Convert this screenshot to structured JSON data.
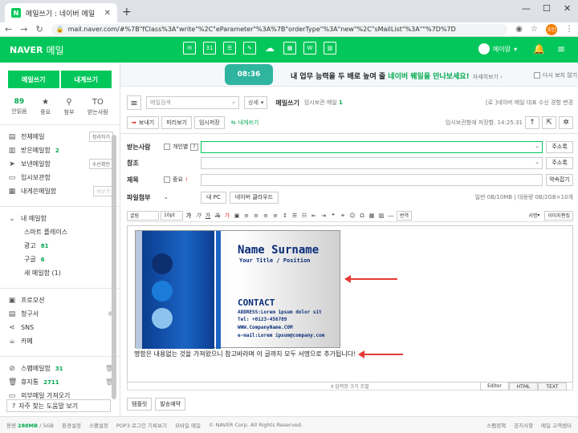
{
  "browser": {
    "tab_title": "메일쓰기 : 네이버 메일",
    "favicon": "N",
    "url": "mail.naver.com/#%7B\"fClass%3A\"write\"%2C\"eParameter\"%3A%7B\"orderType\"%3A\"new\"%2C\"sMailList\"%3A\"\"%7D%7D",
    "profile_label": "초안"
  },
  "gnb": {
    "logo_brand": "NAVER",
    "logo_service": "메일",
    "user_name": "메이랑",
    "calendar_day": "31"
  },
  "sidebar": {
    "write_btn": "메일쓰기",
    "self_btn": "내게쓰기",
    "quick": [
      {
        "count": "89",
        "label": "안읽음"
      },
      {
        "icon": "★",
        "label": "중요"
      },
      {
        "icon": "⚲",
        "label": "첨부"
      },
      {
        "icon": "TO",
        "label": "받는사람"
      }
    ],
    "folders": [
      {
        "label": "전체메일",
        "btn": "정리하기"
      },
      {
        "label": "받은메일함",
        "count": "2"
      },
      {
        "label": "보낸메일함",
        "btn": "수신확인"
      },
      {
        "label": "임시보관함"
      },
      {
        "label": "내게쓴메일함",
        "btn": "비우기"
      }
    ],
    "my_folder": "내 메일함",
    "subfolders": [
      {
        "label": "스마트 플레이스"
      },
      {
        "label": "광고",
        "count": "81"
      },
      {
        "label": "구글",
        "count": "6"
      },
      {
        "label": "새 메일함 (1)"
      }
    ],
    "extras": [
      {
        "label": "프로모션"
      },
      {
        "label": "청구서"
      },
      {
        "label": "SNS"
      },
      {
        "label": "카페"
      }
    ],
    "bottom_folders": [
      {
        "label": "스팸메일함",
        "count": "31"
      },
      {
        "label": "휴지통",
        "count": "2711"
      },
      {
        "label": "외부메일 가져오기"
      }
    ],
    "help": "자주 찾는 도움말 보기"
  },
  "banner": {
    "phone_time": "08:36",
    "text_a": "내 업무 능력을 두 배로 높여 줄 ",
    "text_b": "네이버 웨일을 만나보세요!",
    "more": "자세히보기 ›",
    "hide": "다시 보지 않기"
  },
  "toolbar": {
    "search_placeholder": "메일검색",
    "detail": "상세",
    "title": "메일쓰기",
    "sub_prefix": "임시보관 메일",
    "sub_count": "1",
    "right": "[로 ]네이버 메일 대표 수신 경험 변경",
    "send": "보내기",
    "preview": "미리보기",
    "save": "임시저장",
    "self": "내게쓰기",
    "autosave": "임시보관함에 저장함. 14:25:31"
  },
  "form": {
    "to_label": "받는사람",
    "to_opt": "개인별",
    "q": "?",
    "addr_btn": "주소록",
    "cc_label": "참조",
    "subject_label": "제목",
    "important": "중요",
    "important_mark": "!",
    "sig_btn": "약속잡기",
    "attach_label": "파일첨부",
    "mypc": "내 PC",
    "cloud": "네이버 클라우드",
    "attach_info": "일반 0B/10MB  |  대용량 0B/2GB×10개"
  },
  "editor_toolbar": {
    "font": "굴림",
    "size": "10pt",
    "translate": "번역",
    "signature": "서명",
    "template": "이미지편집"
  },
  "card": {
    "name": "Name Surname",
    "position": "Your Title / Position",
    "contact": "CONTACT",
    "address": "ADDRESS:Lorem ipsum dolor sit",
    "tel": "Tel: +0123-456789",
    "www": "WWW.CompanyName.COM",
    "email": "e-mail:Lorem ipsum@company.com"
  },
  "note": "명함은 내용없는 것을 가져왔으니 참고바라며 이 글까지 모두 서명으로 추가됩니다!",
  "editor_modes": [
    "Editor",
    "HTML",
    "TEXT"
  ],
  "resize": "‡ 입력창 크기 조절",
  "bottom_btns": [
    "템플릿",
    "발송예약"
  ],
  "footer": {
    "usage_label": "용량",
    "usage": "288MB",
    "total": "/ 5GB",
    "links": [
      "환경설정",
      "스팸설정",
      "POP3 로그인 기록보기",
      "모바일 메일"
    ],
    "copyright": "© NAVER Corp. All Rights Reserved.",
    "right_links": [
      "스팸정책",
      "공지사항",
      "메일 고객센터"
    ]
  },
  "colors": {
    "brand": "#03c75a",
    "count": "#03a94f",
    "arrow": "#e53935"
  }
}
